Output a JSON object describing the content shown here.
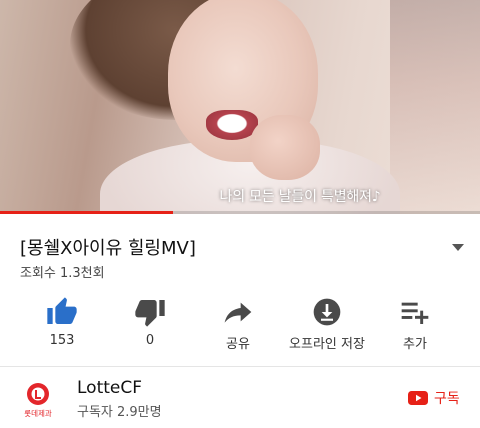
{
  "video": {
    "subtitle": "나의 모든 날들이 특별해져♪",
    "progress": 0.36
  },
  "info": {
    "title": "[몽쉘X아이유 힐링MV]",
    "views": "조회수 1.3천회"
  },
  "actions": [
    {
      "icon": "thumbs-up-icon",
      "label": "153",
      "color": "#2a6fc9"
    },
    {
      "icon": "thumbs-down-icon",
      "label": "0",
      "color": "#4a4a4a"
    },
    {
      "icon": "share-icon",
      "label": "공유",
      "color": "#4a4a4a"
    },
    {
      "icon": "download-icon",
      "label": "오프라인 저장",
      "color": "#4a4a4a"
    },
    {
      "icon": "add-to-playlist-icon",
      "label": "추가",
      "color": "#4a4a4a"
    }
  ],
  "channel": {
    "name": "LotteCF",
    "subscribers": "구독자 2.9만명",
    "logo_text": "롯데제과"
  },
  "subscribe": {
    "label": "구독",
    "color": "#e62117"
  }
}
